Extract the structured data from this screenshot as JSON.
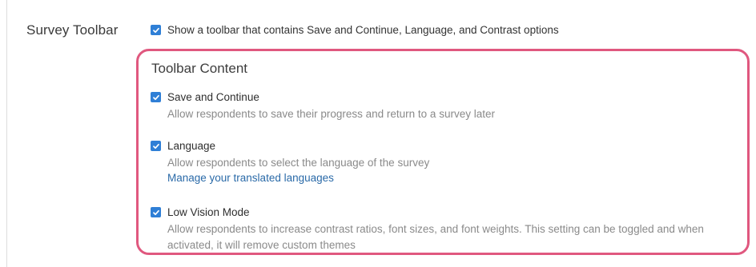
{
  "section": {
    "label": "Survey Toolbar",
    "show_toolbar_label": "Show a toolbar that contains Save and Continue, Language, and Contrast options",
    "show_toolbar_checked": true
  },
  "toolbar_content": {
    "title": "Toolbar Content",
    "items": [
      {
        "label": "Save and Continue",
        "description": "Allow respondents to save their progress and return to a survey later",
        "checked": true
      },
      {
        "label": "Language",
        "description": "Allow respondents to select the language of the survey",
        "link": "Manage your translated languages",
        "checked": true
      },
      {
        "label": "Low Vision Mode",
        "description": "Allow respondents to increase contrast ratios, font sizes, and font weights. This setting can be toggled and when activated, it will remove custom themes",
        "checked": true
      }
    ]
  },
  "colors": {
    "checkbox": "#2f7fd6",
    "highlight": "#e0587f",
    "link": "#2a6aa8"
  }
}
